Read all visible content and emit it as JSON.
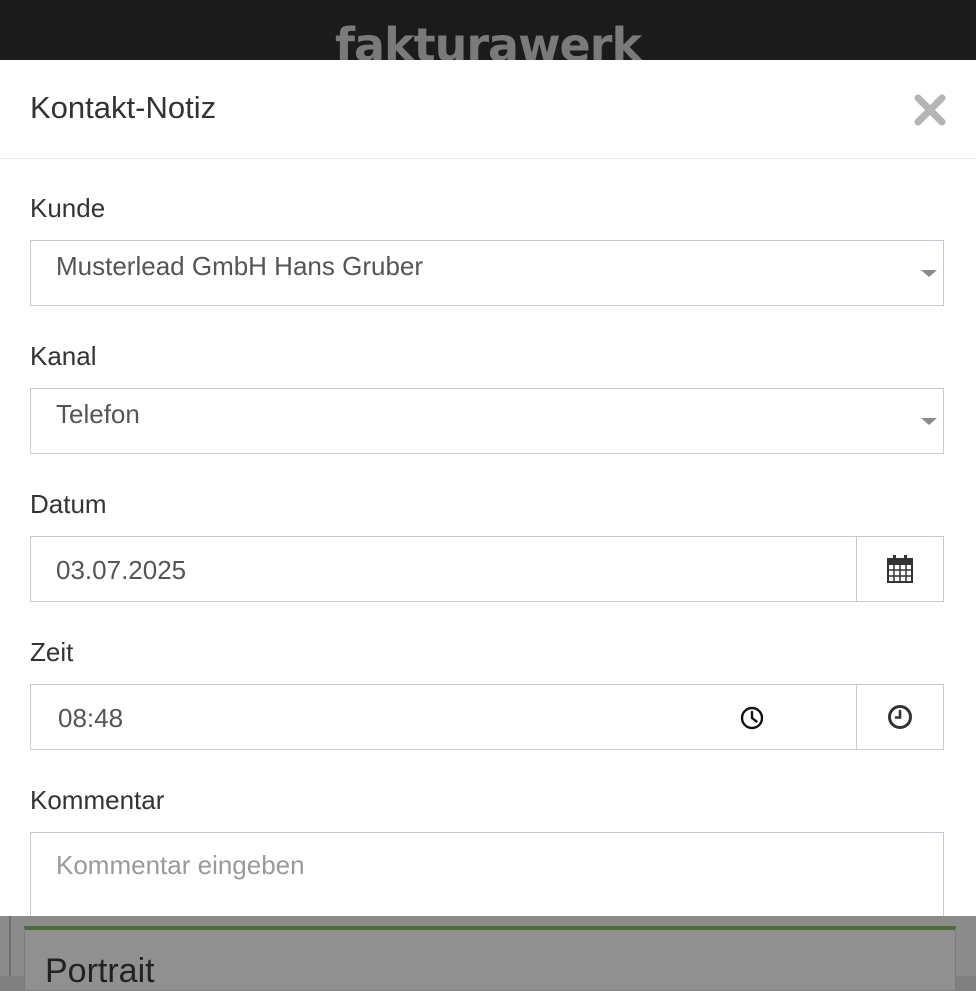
{
  "topbar": {
    "brand": "fakturawerk"
  },
  "background": {
    "card_title": "Portrait"
  },
  "modal": {
    "title": "Kontakt-Notiz",
    "close_icon": "close-icon",
    "fields": {
      "kunde": {
        "label": "Kunde",
        "value": "Musterlead GmbH Hans Gruber"
      },
      "kanal": {
        "label": "Kanal",
        "value": "Telefon"
      },
      "datum": {
        "label": "Datum",
        "value": "03.07.2025",
        "icon": "calendar-icon"
      },
      "zeit": {
        "label": "Zeit",
        "value": "08:48",
        "icon": "clock-icon"
      },
      "kommentar": {
        "label": "Kommentar",
        "placeholder": "Kommentar eingeben"
      }
    }
  },
  "colors": {
    "topbar": "#1b1b1b",
    "brand": "#7a7a7a",
    "field_border": "#c9c9d6",
    "overlay": "#808080",
    "card_accent": "#4f6b3a"
  }
}
